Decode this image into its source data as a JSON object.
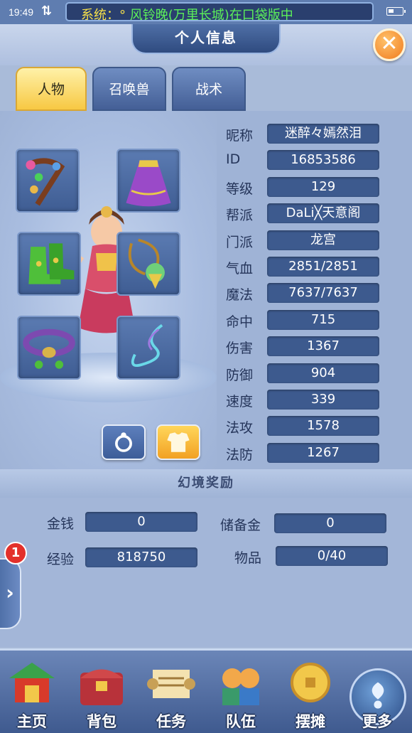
{
  "status_bar": {
    "time": "19:49",
    "network_icon": "updown-arrows-icon",
    "marquee_system": "系统：°",
    "marquee_message": "风铃晚(万里长城)在口袋版中",
    "battery_icon": "battery-icon"
  },
  "header": {
    "title": "个人信息",
    "close_icon": "close-x-icon"
  },
  "tabs": [
    {
      "label": "人物",
      "active": true
    },
    {
      "label": "召唤兽",
      "active": false
    },
    {
      "label": "战术",
      "active": false
    }
  ],
  "stats": [
    {
      "label": "昵称",
      "value": "迷醉々嫣然泪"
    },
    {
      "label": "ID",
      "value": "16853586"
    },
    {
      "label": "等级",
      "value": "129"
    },
    {
      "label": "帮派",
      "value": "DaLi╳天意阁"
    },
    {
      "label": "门派",
      "value": "龙宫"
    },
    {
      "label": "气血",
      "value": "2851/2851"
    },
    {
      "label": "魔法",
      "value": "7637/7637"
    },
    {
      "label": "命中",
      "value": "715"
    },
    {
      "label": "伤害",
      "value": "1367"
    },
    {
      "label": "防御",
      "value": "904"
    },
    {
      "label": "速度",
      "value": "339"
    },
    {
      "label": "法攻",
      "value": "1578"
    },
    {
      "label": "法防",
      "value": "1267"
    }
  ],
  "rewards": {
    "title": "幻境奖励",
    "money_label": "金钱",
    "money_value": "0",
    "reserve_label": "储备金",
    "reserve_value": "0",
    "exp_label": "经验",
    "exp_value": "818750",
    "items_label": "物品",
    "items_value": "0/40"
  },
  "side": {
    "badge": "1",
    "arrow": "›"
  },
  "bottom_nav": [
    {
      "label": "主页",
      "icon": "pavilion-icon"
    },
    {
      "label": "背包",
      "icon": "treasure-chest-icon"
    },
    {
      "label": "任务",
      "icon": "scroll-icon"
    },
    {
      "label": "队伍",
      "icon": "team-icon"
    },
    {
      "label": "摆摊",
      "icon": "coin-icon"
    },
    {
      "label": "更多",
      "icon": "more-orb-icon"
    }
  ],
  "colors": {
    "accent_gold": "#f7c843",
    "panel_blue": "#3d5a8e",
    "close_orange": "#f07a1d"
  }
}
